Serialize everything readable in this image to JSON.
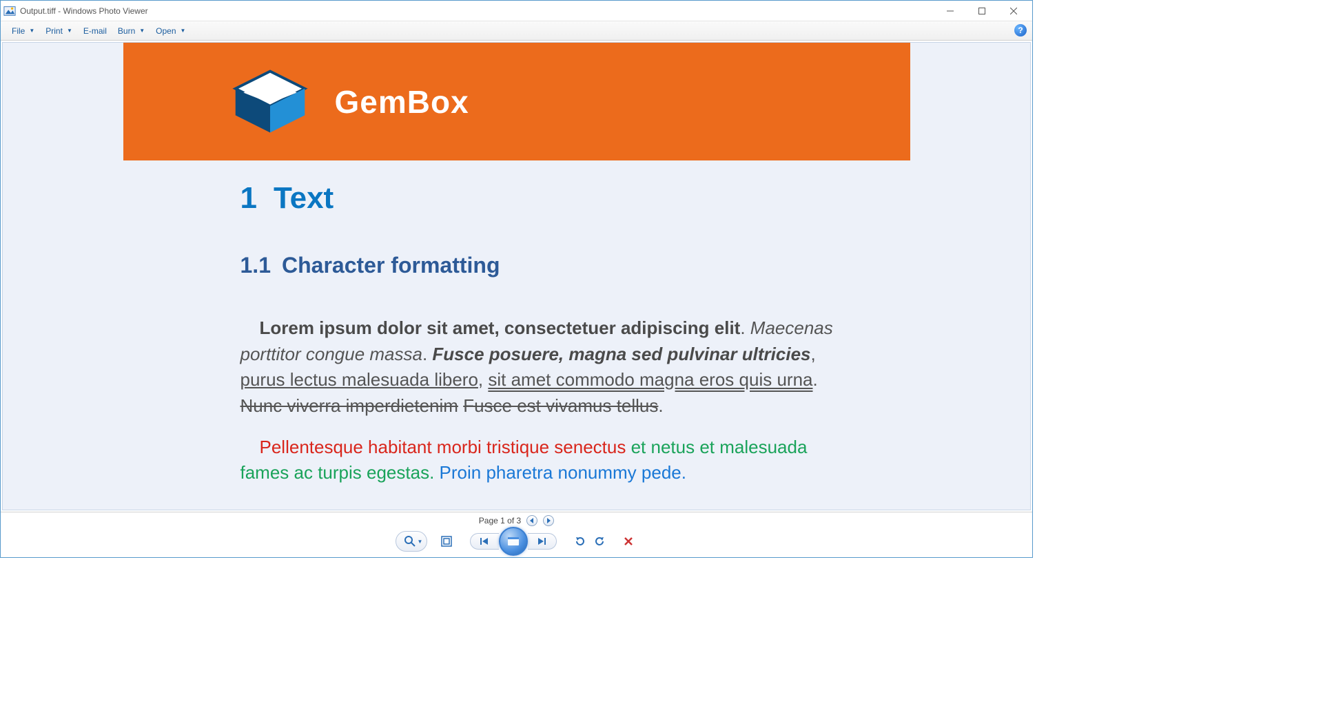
{
  "window": {
    "title": "Output.tiff - Windows Photo Viewer",
    "app_name": "Windows Photo Viewer",
    "file_name": "Output.tiff"
  },
  "menu": {
    "file": "File",
    "print": "Print",
    "email": "E-mail",
    "burn": "Burn",
    "open": "Open"
  },
  "icons": {
    "help": "?",
    "chevron": "▼"
  },
  "status": {
    "page_label": "Page 1 of 3",
    "current_page": 1,
    "total_pages": 3
  },
  "toolbar": {
    "zoom": "zoom",
    "fit": "fit-window",
    "prev": "previous",
    "play": "slideshow",
    "next": "next",
    "rotate_ccw": "rotate-left",
    "rotate_cw": "rotate-right",
    "delete": "delete"
  },
  "document": {
    "brand": "GemBox",
    "h1_num": "1",
    "h1_text": "Text",
    "h2_num": "1.1",
    "h2_text": "Character formatting",
    "p1": {
      "bold": "Lorem ipsum dolor sit amet, consectetuer adipiscing elit",
      "dot1": ". ",
      "italic": "Maecenas porttitor congue massa",
      "dot2": ". ",
      "bolditalic": "Fusce posuere, magna sed pulvinar ultricies",
      "comma": ", ",
      "underline": "purus lectus malesuada libero",
      "comma2": ", ",
      "dblunder": "sit amet commodo magna eros quis urna",
      "dot3": ". ",
      "strike1": "Nunc viverra imperdietenim",
      "space": " ",
      "strike2": "Fusce est vivamus tellus",
      "dot4": "."
    },
    "p2": {
      "red": "Pellentesque habitant morbi tristique senectus",
      "green": " et netus et malesuada fames ac turpis egestas.",
      "blue": " Proin pharetra nonummy pede."
    }
  }
}
